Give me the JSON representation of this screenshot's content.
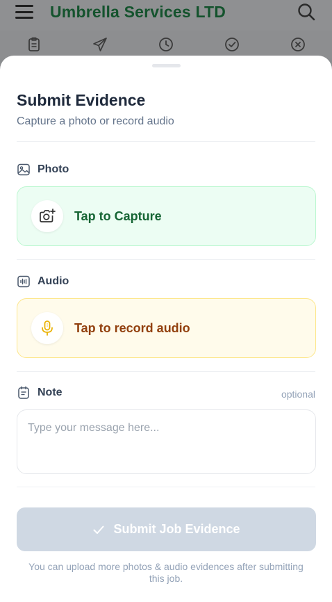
{
  "app": {
    "title": "Umbrella Services LTD",
    "menu_icon": "hamburger-menu-icon",
    "search_icon": "search-icon",
    "tabs": [
      {
        "icon": "clipboard-icon"
      },
      {
        "icon": "paper-plane-icon"
      },
      {
        "icon": "clock-icon"
      },
      {
        "icon": "check-circle-icon"
      },
      {
        "icon": "x-circle-icon"
      }
    ]
  },
  "sheet": {
    "title": "Submit Evidence",
    "subtitle": "Capture a photo or record audio",
    "photo": {
      "label": "Photo",
      "icon": "image-icon",
      "action_label": "Tap to Capture",
      "action_icon": "camera-plus-icon"
    },
    "audio": {
      "label": "Audio",
      "icon": "audio-wave-icon",
      "action_label": "Tap to record audio",
      "action_icon": "microphone-icon"
    },
    "note": {
      "label": "Note",
      "icon": "note-icon",
      "optional_label": "optional",
      "placeholder": "Type your message here...",
      "value": ""
    },
    "submit": {
      "label": "Submit Job Evidence",
      "icon": "check-icon",
      "enabled": false
    },
    "footnote": "You can upload more photos & audio evidences after submitting this job."
  },
  "colors": {
    "brand_green": "#14532d",
    "photo_bg": "#ecfdf3",
    "audio_bg": "#fffbeb",
    "submit_disabled": "#cfd8e3"
  }
}
